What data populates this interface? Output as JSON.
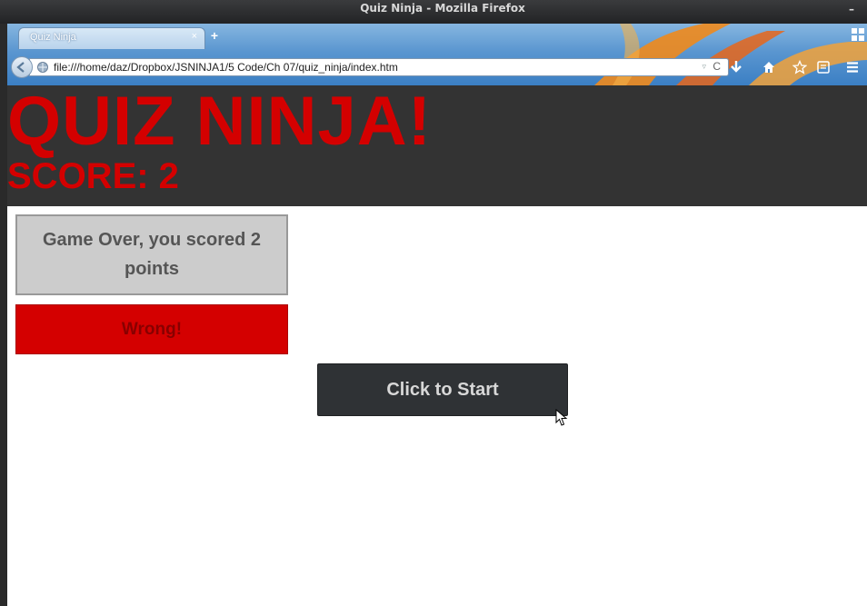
{
  "window": {
    "title": "Quiz Ninja - Mozilla Firefox",
    "minimize_glyph": "–"
  },
  "tabs": [
    {
      "label": "Quiz Ninja",
      "close_glyph": "×"
    }
  ],
  "toolbar": {
    "new_tab_glyph": "+",
    "url": "file:///home/daz/Dropbox/JSNINJA1/5 Code/Ch 07/quiz_ninja/index.htm",
    "dropmarker_glyph": "▿",
    "reload_glyph": "C",
    "icons": [
      "back-icon",
      "download-icon",
      "home-icon",
      "bookmark-star-icon",
      "bookmarks-menu-icon",
      "menu-icon"
    ]
  },
  "game": {
    "title": "QUIZ NINJA!",
    "score_label": "SCORE: 2",
    "question_text": "Game Over, you scored 2 points",
    "feedback_text": "Wrong!",
    "start_button_label": "Click to Start"
  },
  "colors": {
    "header_bg": "#333333",
    "title_red": "#d40000",
    "question_bg": "#cccccc",
    "feedback_bg": "#d40000",
    "button_bg": "#2f3235"
  }
}
